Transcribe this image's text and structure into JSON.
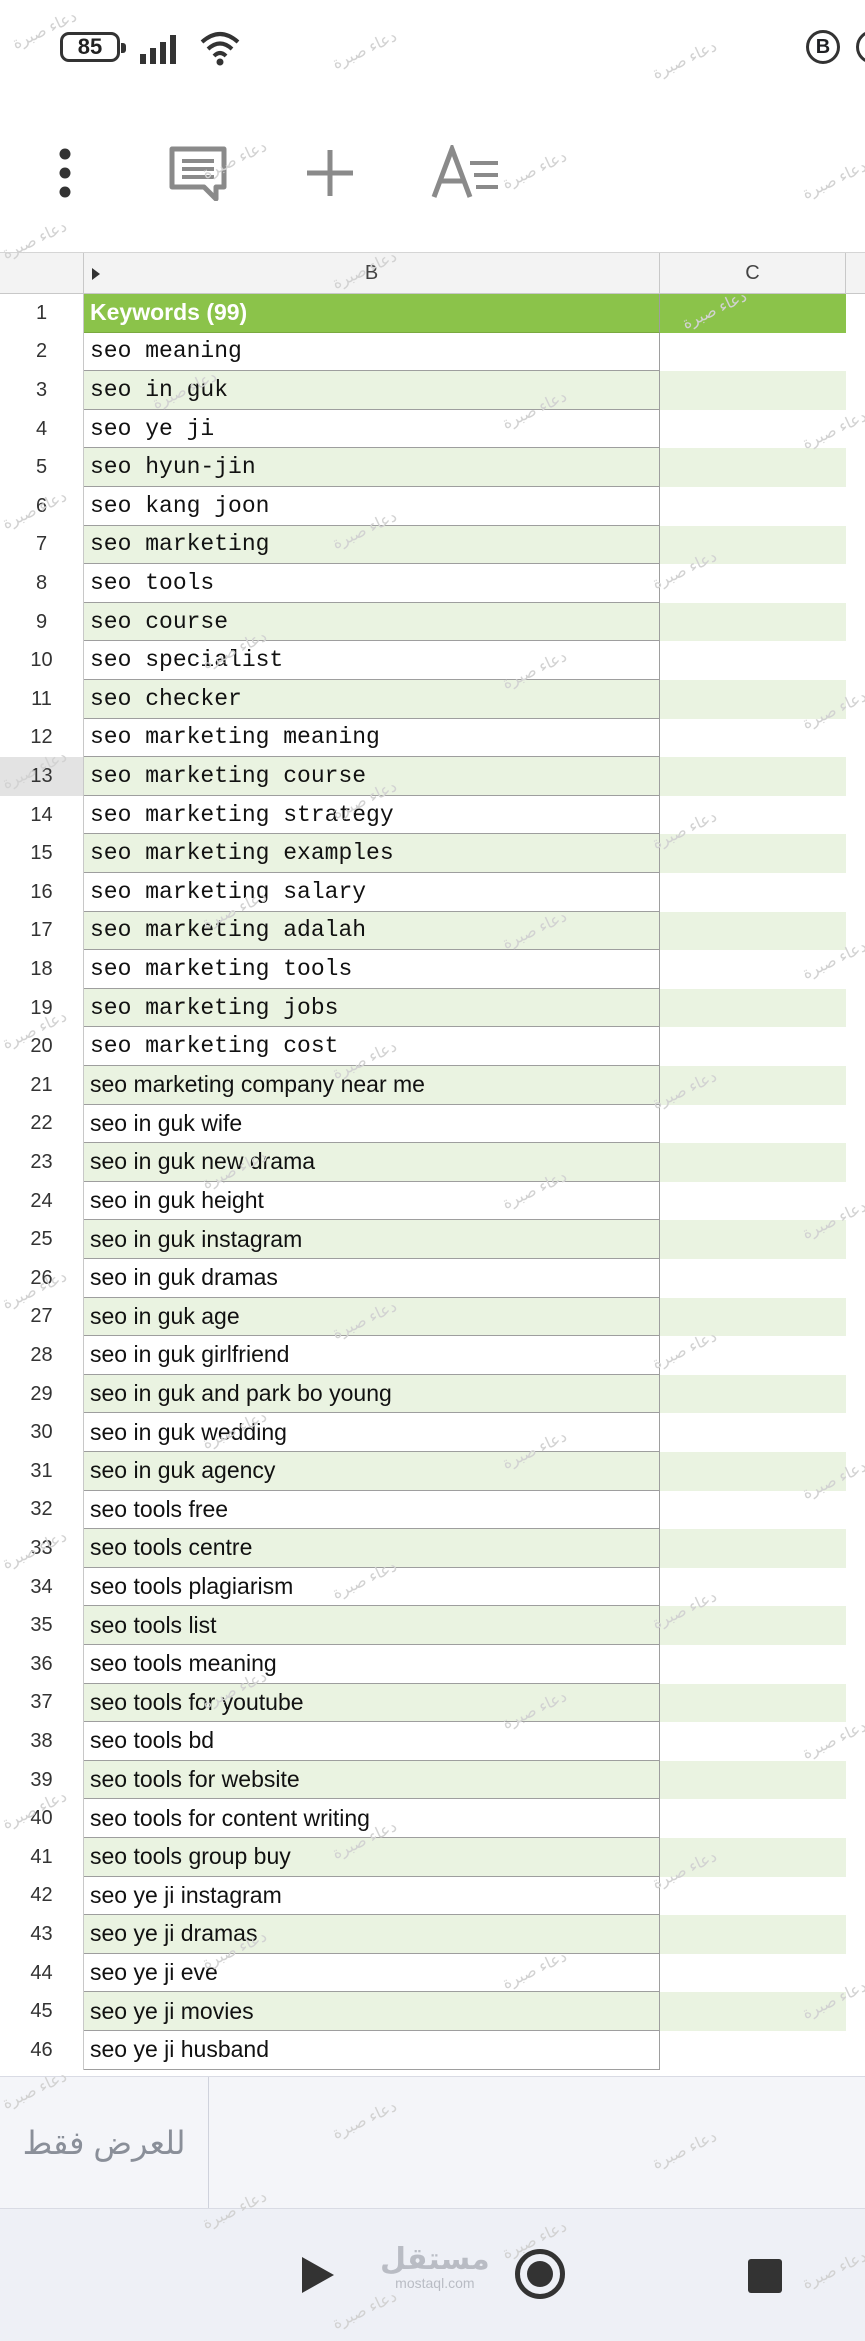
{
  "status_bar": {
    "battery": "85",
    "status_badge": "B"
  },
  "columns": {
    "b": "B",
    "c": "C"
  },
  "selected_row": 13,
  "rows": [
    {
      "n": "1",
      "text": "Keywords (99)"
    },
    {
      "n": "2",
      "text": "seo meaning"
    },
    {
      "n": "3",
      "text": "seo in guk"
    },
    {
      "n": "4",
      "text": "seo ye ji"
    },
    {
      "n": "5",
      "text": "seo hyun-jin"
    },
    {
      "n": "6",
      "text": "seo kang joon"
    },
    {
      "n": "7",
      "text": "seo marketing"
    },
    {
      "n": "8",
      "text": "seo tools"
    },
    {
      "n": "9",
      "text": "seo course"
    },
    {
      "n": "10",
      "text": "seo specialist"
    },
    {
      "n": "11",
      "text": "seo checker"
    },
    {
      "n": "12",
      "text": "seo marketing meaning"
    },
    {
      "n": "13",
      "text": "seo marketing course"
    },
    {
      "n": "14",
      "text": "seo marketing strategy"
    },
    {
      "n": "15",
      "text": "seo marketing examples"
    },
    {
      "n": "16",
      "text": "seo marketing salary"
    },
    {
      "n": "17",
      "text": "seo marketing adalah"
    },
    {
      "n": "18",
      "text": "seo marketing tools"
    },
    {
      "n": "19",
      "text": "seo marketing jobs"
    },
    {
      "n": "20",
      "text": "seo marketing cost"
    },
    {
      "n": "21",
      "text": "seo marketing company near me"
    },
    {
      "n": "22",
      "text": "seo in guk wife"
    },
    {
      "n": "23",
      "text": "seo in guk new drama"
    },
    {
      "n": "24",
      "text": "seo in guk height"
    },
    {
      "n": "25",
      "text": "seo in guk instagram"
    },
    {
      "n": "26",
      "text": "seo in guk dramas"
    },
    {
      "n": "27",
      "text": "seo in guk age"
    },
    {
      "n": "28",
      "text": "seo in guk girlfriend"
    },
    {
      "n": "29",
      "text": "seo in guk and park bo young"
    },
    {
      "n": "30",
      "text": "seo in guk wedding"
    },
    {
      "n": "31",
      "text": "seo in guk agency"
    },
    {
      "n": "32",
      "text": "seo tools free"
    },
    {
      "n": "33",
      "text": "seo tools centre"
    },
    {
      "n": "34",
      "text": "seo tools plagiarism"
    },
    {
      "n": "35",
      "text": "seo tools list"
    },
    {
      "n": "36",
      "text": "seo tools meaning"
    },
    {
      "n": "37",
      "text": "seo tools for youtube"
    },
    {
      "n": "38",
      "text": "seo tools bd"
    },
    {
      "n": "39",
      "text": "seo tools for website"
    },
    {
      "n": "40",
      "text": "seo tools for content writing"
    },
    {
      "n": "41",
      "text": "seo tools group buy"
    },
    {
      "n": "42",
      "text": "seo ye ji instagram"
    },
    {
      "n": "43",
      "text": "seo ye ji dramas"
    },
    {
      "n": "44",
      "text": "seo ye ji eve"
    },
    {
      "n": "45",
      "text": "seo ye ji movies"
    },
    {
      "n": "46",
      "text": "seo ye ji husband"
    }
  ],
  "bottom_panel": {
    "view_only": "للعرض فقط"
  },
  "brand": {
    "arabic": "مستقل",
    "latin": "mostaql.com"
  },
  "watermark": "دعاء صبرة"
}
